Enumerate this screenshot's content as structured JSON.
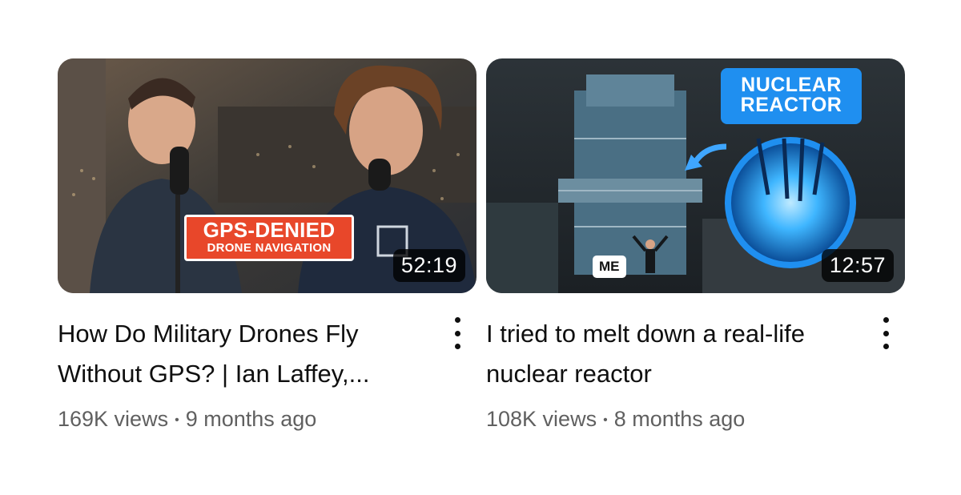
{
  "videos": [
    {
      "title": "How Do Military Drones Fly Without GPS? | Ian Laffey,...",
      "duration": "52:19",
      "views": "169K views",
      "age": "9 months ago",
      "thumbnail_text": {
        "line1": "GPS-DENIED",
        "line2": "DRONE NAVIGATION"
      },
      "thumbnail_colors": {
        "badge": "#e8472a"
      }
    },
    {
      "title": "I tried to melt down a real-life nuclear reactor",
      "duration": "12:57",
      "views": "108K views",
      "age": "8 months ago",
      "thumbnail_text": {
        "line1": "NUCLEAR",
        "line2": "REACTOR",
        "tag": "ME"
      },
      "thumbnail_colors": {
        "badge": "#1f8ff0",
        "glow": "#2ea8ff"
      }
    }
  ],
  "separator": "•",
  "icons": {
    "menu": "more-vert-icon"
  }
}
